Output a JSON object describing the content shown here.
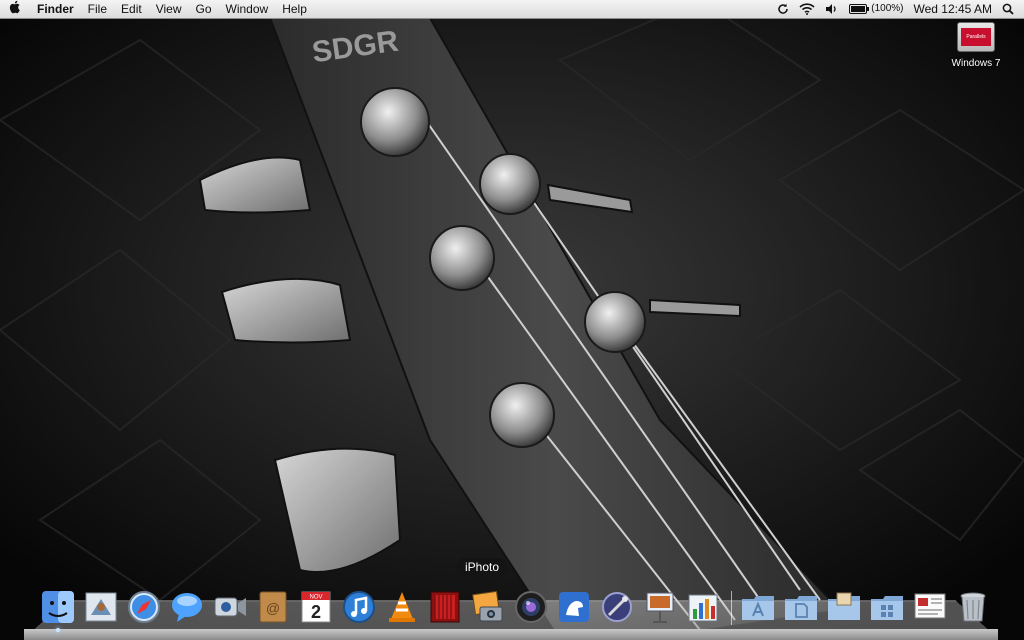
{
  "menubar": {
    "apple_icon": "apple-logo-icon",
    "app_name": "Finder",
    "menus": [
      "File",
      "Edit",
      "View",
      "Go",
      "Window",
      "Help"
    ],
    "extras": {
      "sync_icon": "sync-icon",
      "wifi_icon": "wifi-icon",
      "volume_icon": "volume-icon",
      "battery_icon": "battery-icon",
      "battery_percent": "(100%)",
      "clock": "Wed 12:45 AM",
      "spotlight_icon": "spotlight-search-icon"
    }
  },
  "desktop": {
    "wallpaper": "black-and-white bass guitar headstock",
    "icons": [
      {
        "label": "Windows 7",
        "icon": "parallels-vm-icon",
        "badge_text": "Parallels"
      }
    ]
  },
  "dock": {
    "tooltip": "iPhoto",
    "items": [
      {
        "name": "finder-icon",
        "running": true
      },
      {
        "name": "mail-icon",
        "running": false
      },
      {
        "name": "safari-icon",
        "running": false
      },
      {
        "name": "ichat-icon",
        "running": false
      },
      {
        "name": "facetime-icon",
        "running": false
      },
      {
        "name": "address-book-icon",
        "running": false
      },
      {
        "name": "ical-icon",
        "running": false,
        "date_number": "2",
        "date_month": "NOV"
      },
      {
        "name": "itunes-icon",
        "running": false
      },
      {
        "name": "vlc-icon",
        "running": false
      },
      {
        "name": "photo-booth-icon",
        "running": false
      },
      {
        "name": "iphoto-icon",
        "running": false
      },
      {
        "name": "aperture-icon",
        "running": false
      },
      {
        "name": "cyberduck-icon",
        "running": false
      },
      {
        "name": "automator-icon",
        "running": false
      },
      {
        "name": "keynote-icon",
        "running": false
      },
      {
        "name": "numbers-icon",
        "running": false
      }
    ],
    "stacks": [
      {
        "name": "applications-folder-icon"
      },
      {
        "name": "documents-folder-icon"
      },
      {
        "name": "downloads-folder-icon"
      },
      {
        "name": "windows-folder-icon"
      },
      {
        "name": "preview-document-icon"
      },
      {
        "name": "trash-icon"
      }
    ]
  }
}
